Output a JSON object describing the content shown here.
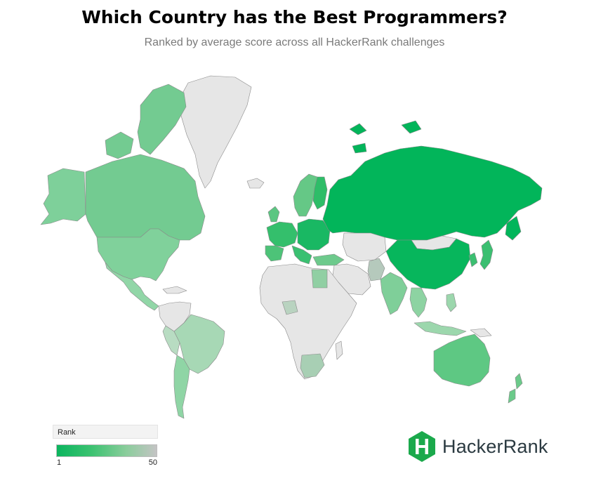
{
  "header": {
    "title": "Which Country has the Best Programmers?",
    "subtitle": "Ranked by average score across all HackerRank challenges"
  },
  "legend": {
    "title": "Rank",
    "min_label": "1",
    "max_label": "50",
    "color_low": "#0bb55e",
    "color_high": "#c4c4c4"
  },
  "brand": {
    "name": "HackerRank",
    "logo_icon": "hackerrank-hexagon-logo",
    "logo_color": "#1ba94c"
  },
  "colors": {
    "no_data": "#e6e6e6",
    "border": "#8a8a8a"
  }
}
